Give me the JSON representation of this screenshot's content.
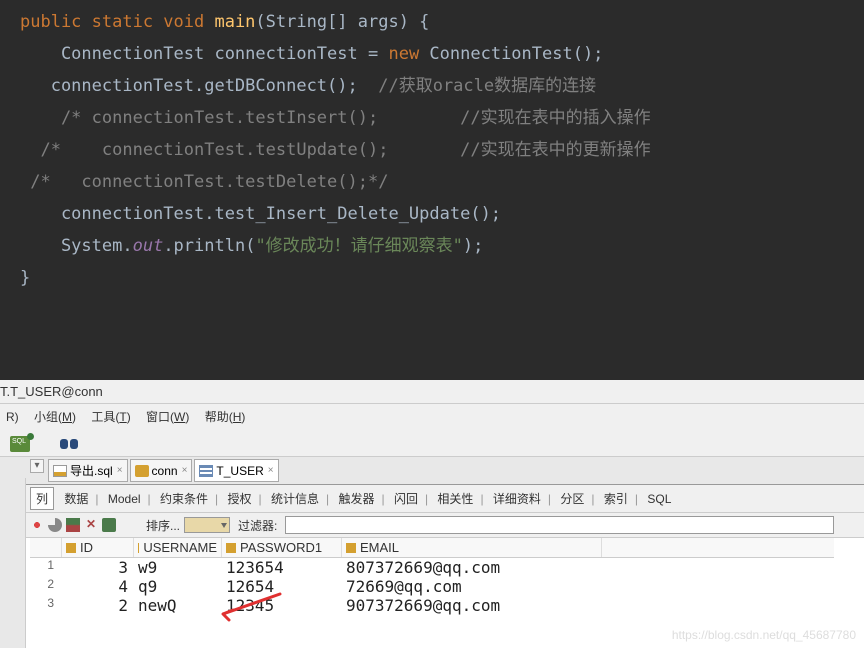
{
  "code": {
    "l1_pre": "public static void ",
    "l1_main": "main",
    "l1_post": "(String[] args) {",
    "l2_a": "    ConnectionTest connectionTest = ",
    "l2_new": "new ",
    "l2_b": "ConnectionTest();",
    "l3_a": "   connectionTest.getDBConnect();  ",
    "l3_c": "//获取oracle数据库的连接",
    "l4": "    /* connectionTest.testInsert();        //实现在表中的插入操作",
    "l5": "  /*    connectionTest.testUpdate();       //实现在表中的更新操作",
    "l6": " /*   connectionTest.testDelete();*/",
    "l7": "",
    "l8": "    connectionTest.test_Insert_Delete_Update();",
    "l9": "",
    "l10_a": "    System.",
    "l10_out": "out",
    "l10_b": ".println(",
    "l10_str": "\"修改成功！请仔细观察表\"",
    "l10_c": ");",
    "l11": "}"
  },
  "title": "T.T_USER@conn",
  "menu": {
    "r": "R)",
    "group_pre": "小组(",
    "group_u": "M",
    "group_post": ")",
    "tools_pre": "工具(",
    "tools_u": "T",
    "tools_post": ")",
    "window_pre": "窗口(",
    "window_u": "W",
    "window_post": ")",
    "help_pre": "帮助(",
    "help_u": "H",
    "help_post": ")"
  },
  "tabs": {
    "t1": "导出.sql",
    "t2": "conn",
    "t3": "T_USER"
  },
  "subtabs": {
    "col": "列",
    "data": "数据",
    "model": "Model",
    "constraint": "约束条件",
    "grant": "授权",
    "stats": "统计信息",
    "trigger": "触发器",
    "flash": "闪回",
    "dep": "相关性",
    "detail": "详细资料",
    "part": "分区",
    "index": "索引",
    "sql": "SQL"
  },
  "filter": {
    "sort": "排序...",
    "filter": "过滤器:"
  },
  "grid": {
    "h_id": "ID",
    "h_user": "USERNAME",
    "h_pass": "PASSWORD1",
    "h_email": "EMAIL",
    "rows": [
      {
        "n": "1",
        "id": "3",
        "user": "w9",
        "pass": "123654",
        "email": "807372669@qq.com"
      },
      {
        "n": "2",
        "id": "4",
        "user": "q9",
        "pass": "12654",
        "email": "72669@qq.com"
      },
      {
        "n": "3",
        "id": "2",
        "user": "newQ",
        "pass": "12345",
        "email": "907372669@qq.com"
      }
    ]
  },
  "watermark": "https://blog.csdn.net/qq_45687780"
}
